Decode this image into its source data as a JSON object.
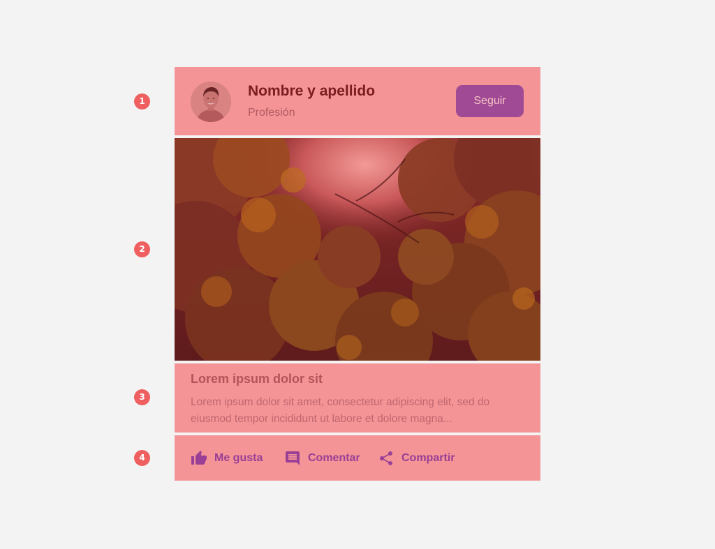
{
  "markers": [
    "1",
    "2",
    "3",
    "4"
  ],
  "header": {
    "name": "Nombre y apellido",
    "profession": "Profesión",
    "follow_label": "Seguir"
  },
  "post": {
    "title": "Lorem ipsum dolor sit",
    "body": "Lorem ipsum dolor sit amet, consectetur adipiscing elit, sed do eiusmod tempor incididunt ut labore et dolore magna..."
  },
  "actions": [
    {
      "label": "Me gusta",
      "icon": "thumb-up-icon"
    },
    {
      "label": "Comentar",
      "icon": "comment-icon"
    },
    {
      "label": "Compartir",
      "icon": "share-icon"
    }
  ],
  "colors": {
    "background": "#f3f3f3",
    "section_fill": "#f49496",
    "marker": "#ef5f60",
    "accent_purple": "#a04a95",
    "name_text": "#7a1c20"
  }
}
